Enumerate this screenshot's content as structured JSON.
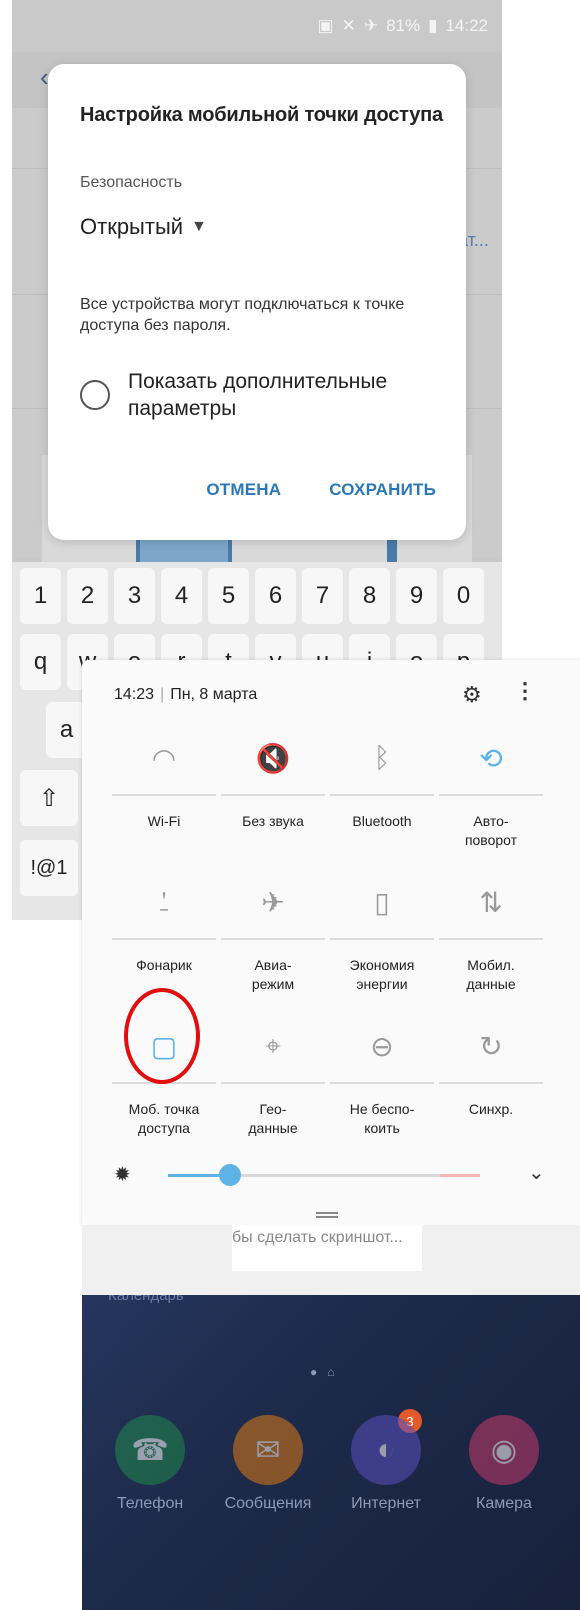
{
  "status_bar": {
    "battery": "81%",
    "time": "14:22"
  },
  "dialog": {
    "title": "Настройка мобильной точки доступа",
    "security_label": "Безопасность",
    "security_value": "Открытый",
    "description": "Все устройства могут подключаться к точке доступа без пароля.",
    "advanced_option": "Показать дополнительные параметры",
    "cancel_label": "ОТМЕНА",
    "save_label": "СОХРАНИТЬ"
  },
  "background_fragments": {
    "right_text": "ат..."
  },
  "keyboard": {
    "numbers": [
      "1",
      "2",
      "3",
      "4",
      "5",
      "6",
      "7",
      "8",
      "9",
      "0"
    ],
    "row_q": [
      "q",
      "w",
      "e",
      "r",
      "t",
      "y",
      "u",
      "i",
      "o",
      "p"
    ],
    "row_a_first": "a",
    "shift_label": "⇧",
    "symbols_label": "!@1"
  },
  "quick_settings": {
    "time": "14:23",
    "date": "Пн, 8 марта",
    "tiles": [
      {
        "label": "Wi-Fi",
        "icon": "wifi-icon",
        "active": false
      },
      {
        "label": "Без звука",
        "icon": "mute-icon",
        "active": false
      },
      {
        "label": "Bluetooth",
        "icon": "bluetooth-icon",
        "active": false
      },
      {
        "label": "Авто-\nповорот",
        "icon": "auto-rotate-icon",
        "active": true
      },
      {
        "label": "Фонарик",
        "icon": "flashlight-icon",
        "active": false
      },
      {
        "label": "Авиа-\nрежим",
        "icon": "airplane-icon",
        "active": false
      },
      {
        "label": "Экономия\nэнергии",
        "icon": "power-saving-icon",
        "active": false
      },
      {
        "label": "Мобил.\nданные",
        "icon": "mobile-data-icon",
        "active": false
      },
      {
        "label": "Моб. точка\nдоступа",
        "icon": "hotspot-icon",
        "active": true
      },
      {
        "label": "Гео-\nданные",
        "icon": "location-icon",
        "active": false
      },
      {
        "label": "Не беспо-\nкоить",
        "icon": "do-not-disturb-icon",
        "active": false
      },
      {
        "label": "Синхр.",
        "icon": "sync-icon",
        "active": false
      }
    ],
    "brightness_level": 0.2,
    "colors": {
      "accent": "#5db3e6",
      "highlight": "#e10e0e"
    }
  },
  "screenshot_hint": "бы сделать скриншот...",
  "home": {
    "calendar_label": "Календарь",
    "apps": [
      {
        "name": "Телефон",
        "icon": "phone-icon",
        "color": "#1f8a4c"
      },
      {
        "name": "Сообщения",
        "icon": "messages-icon",
        "color": "#e07a14"
      },
      {
        "name": "Интернет",
        "icon": "internet-icon",
        "color": "#5b4fc0",
        "badge": "3"
      },
      {
        "name": "Камера",
        "icon": "camera-icon",
        "color": "#c73a6a"
      }
    ]
  }
}
